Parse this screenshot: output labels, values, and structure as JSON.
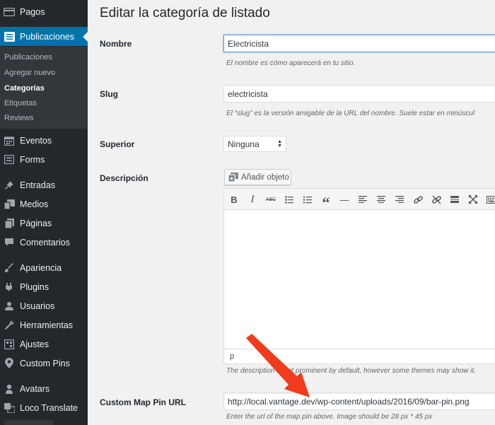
{
  "sidebar": {
    "items": [
      {
        "label": "Pagos",
        "icon": "credit-card-icon"
      },
      {
        "label": "Publicaciones",
        "icon": "list-icon",
        "current": true
      },
      {
        "label": "Eventos",
        "icon": "calendar-icon"
      },
      {
        "label": "Forms",
        "icon": "form-icon"
      },
      {
        "label": "Entradas",
        "icon": "pin-icon"
      },
      {
        "label": "Medios",
        "icon": "media-icon"
      },
      {
        "label": "Páginas",
        "icon": "pages-icon"
      },
      {
        "label": "Comentarios",
        "icon": "comment-icon"
      },
      {
        "label": "Apariencia",
        "icon": "brush-icon"
      },
      {
        "label": "Plugins",
        "icon": "plugin-icon"
      },
      {
        "label": "Usuarios",
        "icon": "user-icon"
      },
      {
        "label": "Herramientas",
        "icon": "wrench-icon"
      },
      {
        "label": "Ajustes",
        "icon": "settings-icon"
      },
      {
        "label": "Custom Pins",
        "icon": "map-pin-icon"
      },
      {
        "label": "Avatars",
        "icon": "avatar-icon"
      },
      {
        "label": "Loco Translate",
        "icon": "translate-icon"
      }
    ],
    "submenu": [
      {
        "label": "Publicaciones"
      },
      {
        "label": "Agregar nuevo"
      },
      {
        "label": "Categorías",
        "current": true
      },
      {
        "label": "Etiquetas"
      },
      {
        "label": "Reviews"
      }
    ]
  },
  "main": {
    "title": "Editar la categoría de listado",
    "name": {
      "label": "Nombre",
      "value": "Electricista",
      "hint": "El nombre es cómo aparecerá en tu sitio."
    },
    "slug": {
      "label": "Slug",
      "value": "electricista",
      "hint": "El “slug” es la versión amigable de la URL del nombre. Suele estar en minúscul"
    },
    "parent": {
      "label": "Superior",
      "value": "Ninguna"
    },
    "description": {
      "label": "Descripción",
      "add_media": "Añadir objeto",
      "status_path": "p",
      "hint": "The description is not prominent by default, however some themes may show it."
    },
    "custom_pin": {
      "label": "Custom Map Pin URL",
      "value": "http://local.vantage.dev/wp-content/uploads/2016/09/bar-pin.png",
      "hint": "Enter the url of the map pin above. Image should be 28 px * 45 px"
    }
  },
  "toolbar": [
    {
      "label": "B",
      "icon": "bold-icon"
    },
    {
      "label": "I",
      "icon": "italic-icon"
    },
    {
      "label": "ABC",
      "icon": "strikethrough-icon"
    },
    {
      "icon": "bullet-list-icon"
    },
    {
      "icon": "numbered-list-icon"
    },
    {
      "label": "“",
      "icon": "blockquote-icon"
    },
    {
      "label": "—",
      "icon": "horizontal-rule-icon"
    },
    {
      "icon": "align-left-icon"
    },
    {
      "icon": "align-center-icon"
    },
    {
      "icon": "align-right-icon"
    },
    {
      "icon": "link-icon"
    },
    {
      "icon": "unlink-icon"
    },
    {
      "icon": "read-more-icon"
    },
    {
      "icon": "fullscreen-icon"
    },
    {
      "icon": "toolbar-toggle-icon"
    }
  ],
  "colors": {
    "sidebar_bg": "#23282d",
    "accent": "#0073aa",
    "arrow": "#f23a1d"
  }
}
